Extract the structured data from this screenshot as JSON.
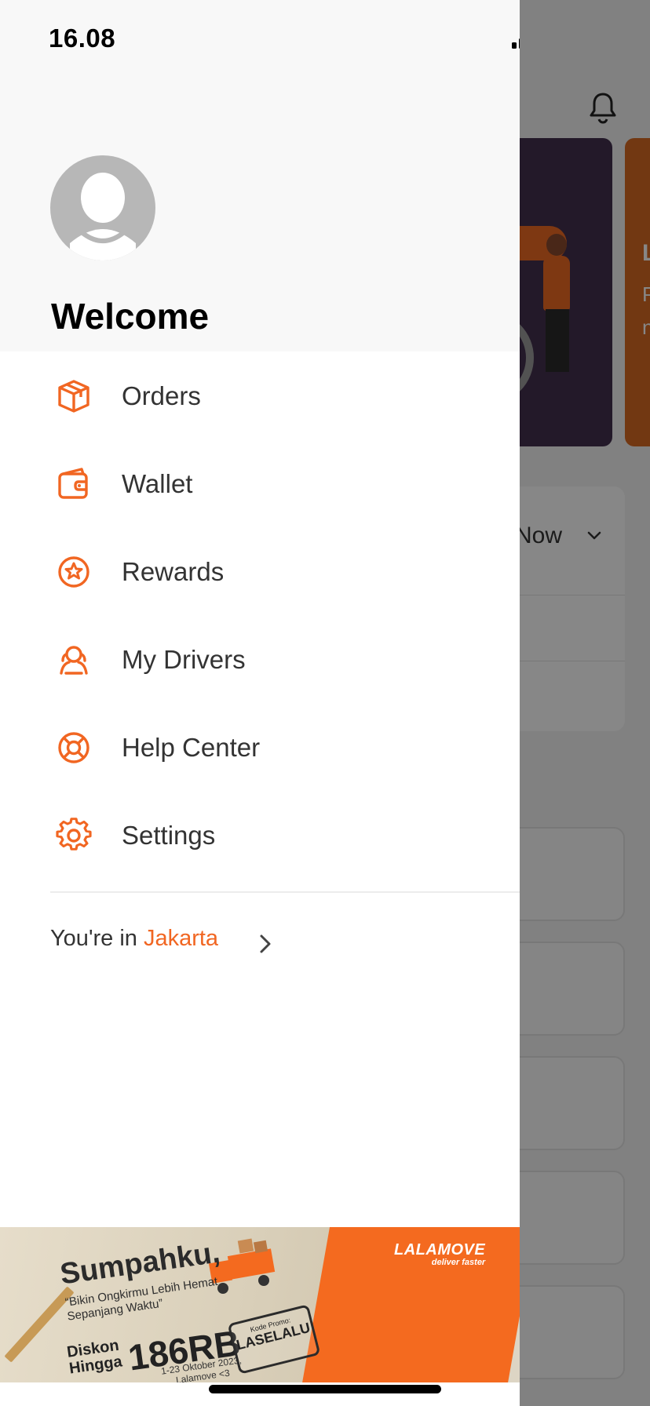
{
  "status_bar": {
    "time": "16.08",
    "icons": [
      "cellular-signal-icon",
      "wifi-icon",
      "battery-icon"
    ]
  },
  "drawer": {
    "welcome": "Welcome",
    "menu": [
      {
        "label": "Orders",
        "icon": "package-icon"
      },
      {
        "label": "Wallet",
        "icon": "wallet-icon"
      },
      {
        "label": "Rewards",
        "icon": "rewards-star-icon"
      },
      {
        "label": "My Drivers",
        "icon": "drivers-icon"
      },
      {
        "label": "Help Center",
        "icon": "lifebuoy-icon"
      },
      {
        "label": "Settings",
        "icon": "gear-icon"
      }
    ],
    "location": {
      "prefix": "You're in",
      "city": "Jakarta"
    },
    "promo": {
      "title": "Sumpahku,",
      "subtitle": "“Bikin Ongkirmu Lebih Hemat Sepanjang Waktu”",
      "discount_label": "Diskon Hingga",
      "amount": "186RB",
      "dates": "1-23 Oktober 2023, Lalamove <3",
      "promo_code_label": "Kode Promo:",
      "promo_code": "LASELALU",
      "brand": "LALAMOVE",
      "tagline": "deliver faster"
    }
  },
  "background": {
    "schedule_value": "Now",
    "card_letter": "L",
    "card_text": [
      "P",
      "n"
    ]
  },
  "colors": {
    "accent": "#f16622",
    "overlay": "#7f7f7f",
    "drawer_header_bg": "#f8f8f8"
  }
}
